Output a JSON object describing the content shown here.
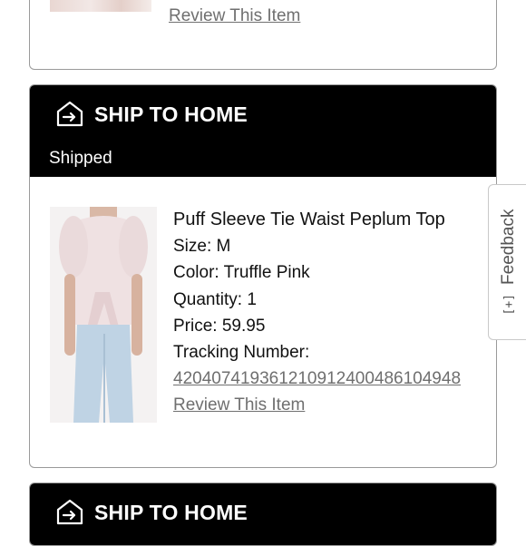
{
  "previous_item": {
    "review_link": "Review This Item"
  },
  "shipment": {
    "header_title": "SHIP TO HOME",
    "status": "Shipped",
    "header_icon": "ship-to-home-icon",
    "item": {
      "name": "Puff Sleeve Tie Waist Peplum Top",
      "size": "Size: M",
      "color": "Color: Truffle Pink",
      "quantity": "Quantity: 1",
      "price": "Price: 59.95",
      "tracking_label": "Tracking Number:",
      "tracking_number": "420407419361210912400486104948",
      "review_link": "Review This Item"
    }
  },
  "next_shipment": {
    "header_title": "SHIP TO HOME",
    "header_icon": "ship-to-home-icon"
  },
  "feedback_tab": {
    "label": "Feedback",
    "glyph": "[+]"
  },
  "colors": {
    "header_bg": "#000000",
    "link_gray": "#6f6f6f",
    "border": "#9a9a9a"
  }
}
